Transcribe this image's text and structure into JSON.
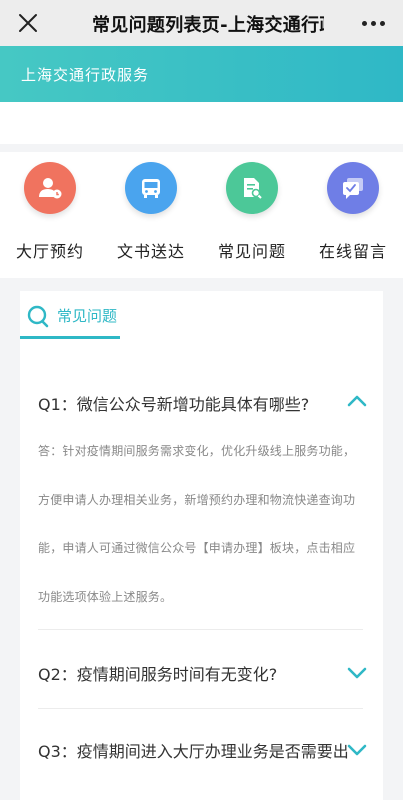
{
  "header": {
    "title": "常见问题列表页-上海交通行政服务",
    "close_icon": "close-icon",
    "more_icon": "more-dots-icon"
  },
  "banner": {
    "text": "上海交通行政服务",
    "color": "#2fb8c6"
  },
  "quick_nav": [
    {
      "label": "大厅预约",
      "icon": "person-appointment-icon",
      "color": "#f0735f"
    },
    {
      "label": "文书送达",
      "icon": "bus-icon",
      "color": "#4aa4ee"
    },
    {
      "label": "常见问题",
      "icon": "document-search-icon",
      "color": "#4cc898"
    },
    {
      "label": "在线留言",
      "icon": "message-icon",
      "color": "#6f7ee6"
    }
  ],
  "faq": {
    "tab_label": "常见问题",
    "items": [
      {
        "question": "Q1：微信公众号新增功能具体有哪些?",
        "expanded": true,
        "answer": "答：针对疫情期间服务需求变化，优化升级线上服务功能，方便申请人办理相关业务，新增预约办理和物流快递查询功能，申请人可通过微信公众号【申请办理】板块，点击相应功能选项体验上述服务。"
      },
      {
        "question": "Q2：疫情期间服务时间有无变化?",
        "expanded": false
      },
      {
        "question": "Q3：疫情期间进入大厅办理业务是否需要出",
        "expanded": false
      }
    ]
  }
}
